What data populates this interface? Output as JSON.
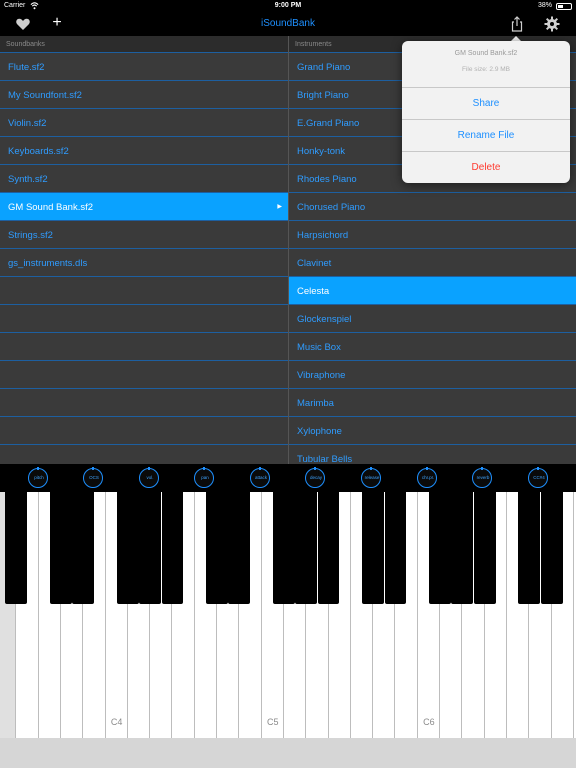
{
  "status_bar": {
    "carrier": "Carrier",
    "time": "9:00 PM",
    "battery": "38%"
  },
  "navbar": {
    "title": "iSoundBank",
    "plus": "+"
  },
  "soundbanks": {
    "header": "Soundbanks",
    "items": [
      {
        "label": "Flute.sf2",
        "selected": false
      },
      {
        "label": "My Soundfont.sf2",
        "selected": false
      },
      {
        "label": "Violin.sf2",
        "selected": false
      },
      {
        "label": "Keyboards.sf2",
        "selected": false
      },
      {
        "label": "Synth.sf2",
        "selected": false
      },
      {
        "label": "GM Sound Bank.sf2",
        "selected": true
      },
      {
        "label": "Strings.sf2",
        "selected": false
      },
      {
        "label": "gs_instruments.dls",
        "selected": false
      },
      {
        "label": "",
        "selected": false
      },
      {
        "label": "",
        "selected": false
      },
      {
        "label": "",
        "selected": false
      },
      {
        "label": "",
        "selected": false
      },
      {
        "label": "",
        "selected": false
      },
      {
        "label": "",
        "selected": false
      },
      {
        "label": "",
        "selected": false
      }
    ]
  },
  "instruments": {
    "header": "Instruments",
    "items": [
      {
        "label": "Grand Piano",
        "selected": false
      },
      {
        "label": "Bright Piano",
        "selected": false
      },
      {
        "label": "E.Grand Piano",
        "selected": false
      },
      {
        "label": "Honky-tonk",
        "selected": false
      },
      {
        "label": "Rhodes Piano",
        "selected": false
      },
      {
        "label": "Chorused Piano",
        "selected": false
      },
      {
        "label": "Harpsichord",
        "selected": false
      },
      {
        "label": "Clavinet",
        "selected": false
      },
      {
        "label": "Celesta",
        "selected": true
      },
      {
        "label": "Glockenspiel",
        "selected": false
      },
      {
        "label": "Music Box",
        "selected": false
      },
      {
        "label": "Vibraphone",
        "selected": false
      },
      {
        "label": "Marimba",
        "selected": false
      },
      {
        "label": "Xylophone",
        "selected": false
      },
      {
        "label": "Tubular Bells",
        "selected": false
      }
    ]
  },
  "popover": {
    "file_name": "GM Sound Bank.sf2",
    "file_size": "File size: 2.9 MB",
    "share": "Share",
    "rename": "Rename File",
    "delete": "Delete"
  },
  "knobs": [
    "pitch",
    "OCS",
    "vol.",
    "pan",
    "attack",
    "decay",
    "release",
    "chr.pr.",
    "reverb",
    "CC#4"
  ],
  "keyboard": {
    "white_key_count": 26,
    "labels": [
      {
        "text": "C4",
        "white_index": 5
      },
      {
        "text": "C5",
        "white_index": 12
      },
      {
        "text": "C6",
        "white_index": 19
      }
    ],
    "pressed_white_index": 0
  },
  "colors": {
    "accent": "#1e90ff",
    "selected_row": "#0aa2ff",
    "delete": "#ff3b30",
    "pane_bg": "#3a3a3a"
  }
}
